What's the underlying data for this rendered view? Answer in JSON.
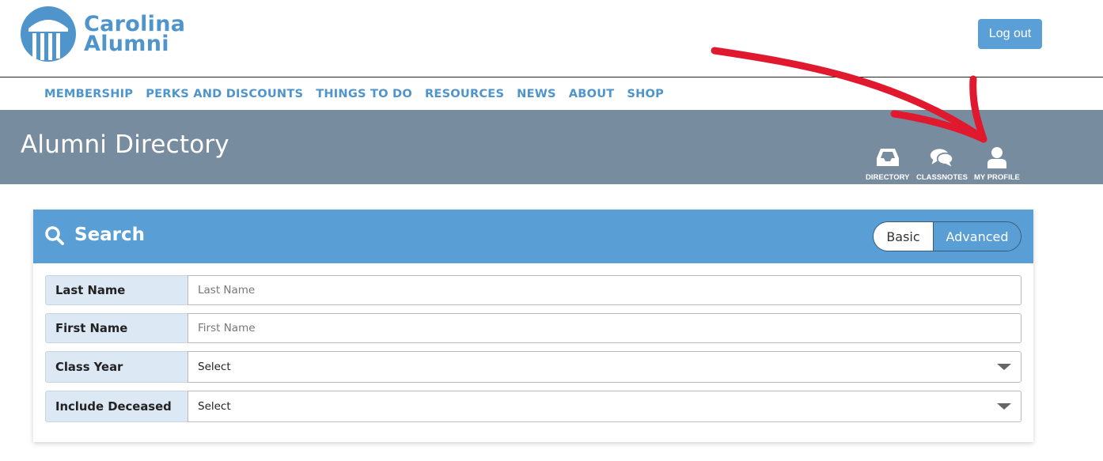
{
  "brand": {
    "line1": "Carolina",
    "line2": "Alumni"
  },
  "header": {
    "logout_label": "Log out"
  },
  "nav": {
    "items": [
      "MEMBERSHIP",
      "PERKS AND DISCOUNTS",
      "THINGS TO DO",
      "RESOURCES",
      "NEWS",
      "ABOUT",
      "SHOP"
    ]
  },
  "banner": {
    "title": "Alumni Directory",
    "icons": [
      {
        "label": "DIRECTORY",
        "icon": "inbox-icon"
      },
      {
        "label": "CLASSNOTES",
        "icon": "comments-icon"
      },
      {
        "label": "MY PROFILE",
        "icon": "user-icon"
      }
    ]
  },
  "search": {
    "title": "Search",
    "toggle": {
      "basic": "Basic",
      "advanced": "Advanced",
      "active": "Advanced"
    },
    "fields": [
      {
        "label": "Last Name",
        "placeholder": "Last Name",
        "type": "text"
      },
      {
        "label": "First Name",
        "placeholder": "First Name",
        "type": "text"
      },
      {
        "label": "Class Year",
        "value": "Select",
        "type": "select"
      },
      {
        "label": "Include Deceased",
        "value": "Select",
        "type": "select"
      }
    ]
  },
  "colors": {
    "brand_blue": "#4f95cc",
    "banner": "#788ca0",
    "search_head": "#599fd5",
    "annotation_red": "#e0192e"
  }
}
